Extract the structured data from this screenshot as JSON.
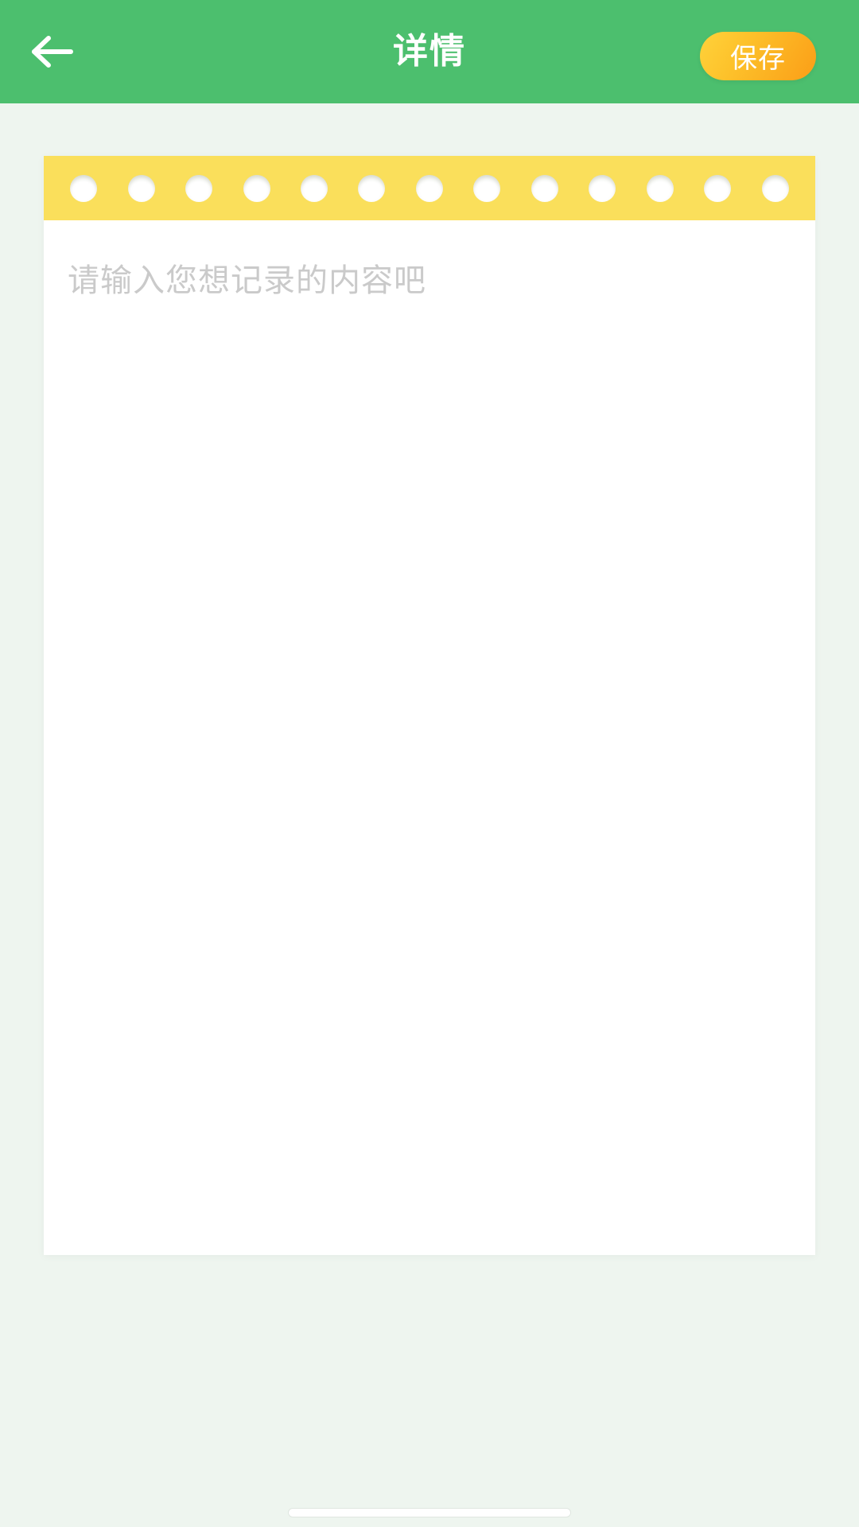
{
  "page": {
    "background_color": "#eef5ef"
  },
  "header": {
    "title": "详情",
    "background_color": "#4cbf6e",
    "back_icon": "arrow-left-icon",
    "save_label": "保存",
    "save_gradient_from": "#ffd23b",
    "save_gradient_to": "#fb9e17"
  },
  "note": {
    "strip_color": "#fadf5b",
    "hole_count": 13,
    "card_color": "#ffffff",
    "placeholder": "请输入您想记录的内容吧",
    "content": "",
    "placeholder_color": "#cacaca"
  },
  "system": {
    "home_indicator": "home-indicator-bar"
  }
}
